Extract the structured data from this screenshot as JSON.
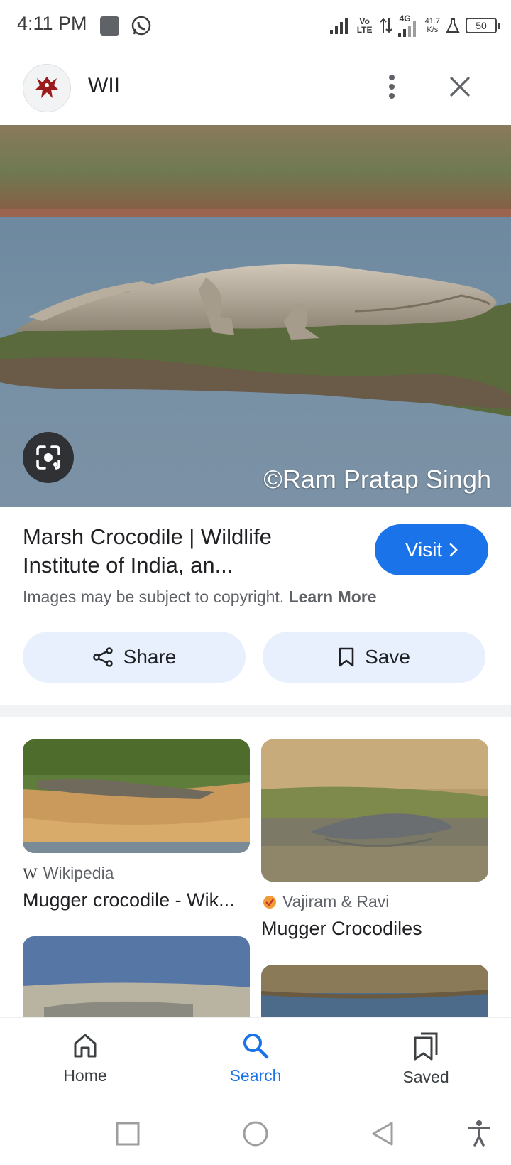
{
  "status_bar": {
    "time": "4:11 PM",
    "network_volte": "Vo LTE",
    "network_gen": "4G",
    "speed_value": "41.7",
    "speed_unit": "K/s",
    "battery": "50"
  },
  "header": {
    "site_name": "WII",
    "more_icon": "more-vert-icon",
    "close_icon": "close-icon"
  },
  "main_image": {
    "watermark": "©Ram Pratap Singh",
    "lens_icon": "google-lens-icon"
  },
  "result": {
    "title": "Marsh Crocodile | Wildlife Institute of India, an...",
    "visit_label": "Visit",
    "copyright_text": "Images may be subject to copyright.",
    "learn_more": "Learn More",
    "share_label": "Share",
    "save_label": "Save"
  },
  "related": [
    {
      "source": "Wikipedia",
      "title": "Mugger crocodile - Wik..."
    },
    {
      "source": "Vajiram & Ravi",
      "title": "Mugger Crocodiles"
    }
  ],
  "bottom_nav": {
    "home": "Home",
    "search": "Search",
    "saved": "Saved"
  },
  "colors": {
    "accent": "#1a73e8",
    "chip_bg": "#e8f0fe"
  }
}
